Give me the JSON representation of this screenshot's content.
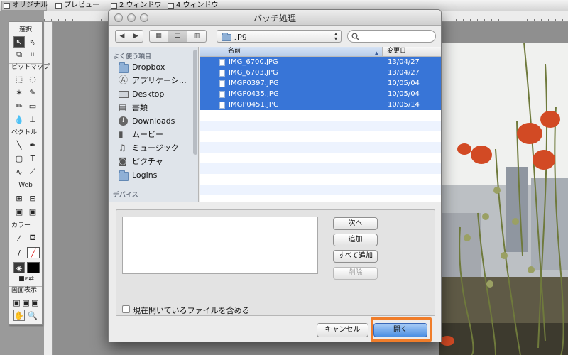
{
  "app": {
    "tabs": [
      "オリジナル",
      "プレビュー",
      "2 ウィンドウ",
      "4 ウィンドウ"
    ]
  },
  "tools": {
    "sections": [
      "選択",
      "ビットマップ",
      "ベクトル",
      "Web",
      "カラー",
      "画面表示"
    ]
  },
  "dialog": {
    "title": "バッチ処理",
    "path_folder": "jpg",
    "search_placeholder": ""
  },
  "sidebar": {
    "favorites_header": "よく使う項目",
    "items": [
      "Dropbox",
      "アプリケーシ…",
      "Desktop",
      "書類",
      "Downloads",
      "ムービー",
      "ミュージック",
      "ピクチャ",
      "Logins"
    ],
    "devices_header": "デバイス"
  },
  "filelist": {
    "col_name": "名前",
    "col_date": "変更日",
    "files": [
      {
        "name": "IMG_6700.JPG",
        "date": "13/04/27"
      },
      {
        "name": "IMG_6703.JPG",
        "date": "13/04/27"
      },
      {
        "name": "IMGP0397.JPG",
        "date": "10/05/04"
      },
      {
        "name": "IMGP0435.JPG",
        "date": "10/05/04"
      },
      {
        "name": "IMGP0451.JPG",
        "date": "10/05/14"
      }
    ]
  },
  "lower": {
    "btn_next": "次へ",
    "btn_add": "追加",
    "btn_add_all": "すべて追加",
    "btn_delete": "削除",
    "include_open_label": "現在開いているファイルを含める"
  },
  "footer": {
    "cancel": "キャンセル",
    "open": "開く"
  },
  "colors": {
    "selection": "#3875d7",
    "highlight": "#f07d2a"
  }
}
